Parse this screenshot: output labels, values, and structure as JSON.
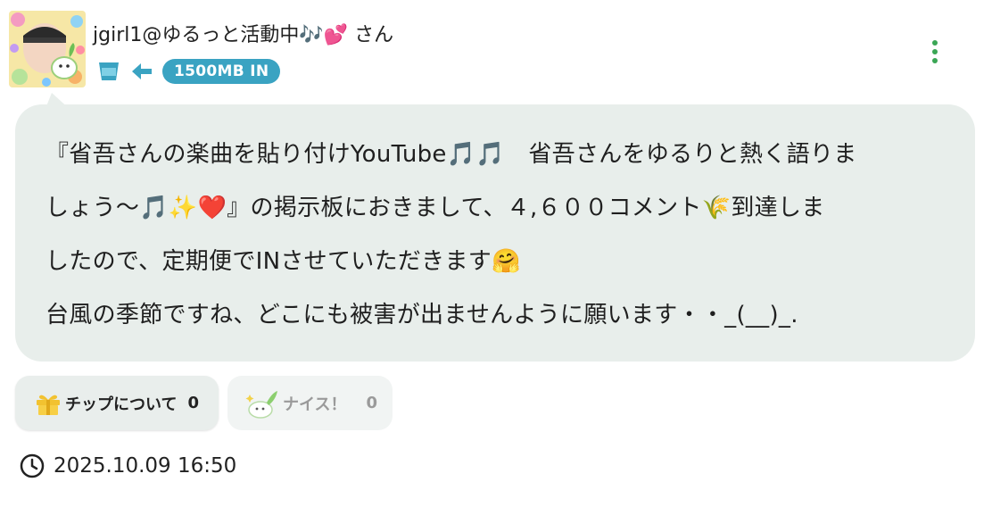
{
  "post": {
    "username": "jgirl1@ゆるっと活動中🎶💕 さん",
    "badge": "1500MB IN",
    "message_lines": [
      "『省吾さんの楽曲を貼り付けYouTube🎵🎵　省吾さんをゆるりと熱く語りま",
      "しょう〜🎵✨❤️』の掲示板におきまして、４,６００コメント🌾到達しま",
      "したので、定期便でINさせていただきます🤗",
      "台風の季節ですね、どこにも被害が出ませんように願います・・_(__)_."
    ],
    "timestamp": "2025.10.09 16:50"
  },
  "actions": {
    "tip_label": "チップについて",
    "tip_count": "0",
    "nice_label": "ナイス！",
    "nice_count": "0"
  },
  "icons": {
    "avatar": "user-avatar-photo",
    "badge_cup": "cup-icon",
    "arrow": "arrow-left-icon",
    "menu": "more-vertical-icon",
    "gift": "gift-icon",
    "nice": "rabbit-sticker-icon",
    "clock": "clock-icon"
  },
  "colors": {
    "accent_blue": "#3aa3c2",
    "bubble_bg": "#e8eeeb",
    "menu_green": "#3aa655",
    "gift_yellow": "#f2c230"
  }
}
